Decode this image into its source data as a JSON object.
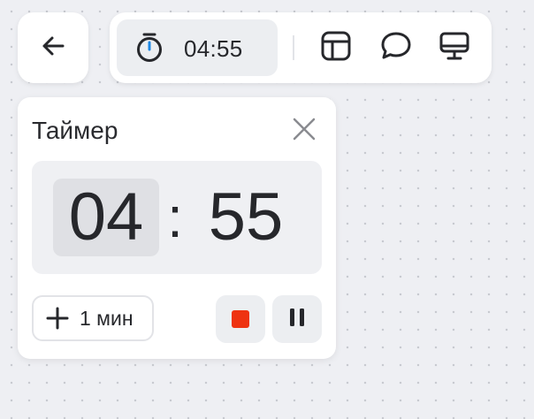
{
  "header": {
    "timer_display": "04:55"
  },
  "icons": {
    "back": "arrow-left-icon",
    "stopwatch": "stopwatch-icon",
    "layout": "layout-panel-icon",
    "chat": "chat-bubble-icon",
    "screen": "monitor-icon",
    "close": "close-icon",
    "plus": "plus-icon",
    "stop": "stop-icon",
    "pause": "pause-icon"
  },
  "timer_panel": {
    "title": "Таймер",
    "minutes": "04",
    "separator": ":",
    "seconds": "55",
    "add_minute_label": "1 мин"
  },
  "colors": {
    "stop": "#ee3311",
    "stopwatch_accent": "#1e88e5",
    "text": "#26272b"
  }
}
